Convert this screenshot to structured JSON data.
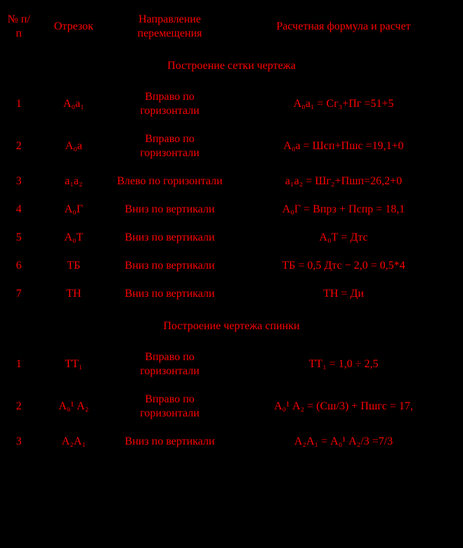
{
  "header": {
    "col_num": "№ п/п",
    "col_segment": "Отрезок",
    "col_direction": "Направление перемещения",
    "col_formula": "Расчетная формула и расчет"
  },
  "section_net": "Построение сетки чертежа",
  "section_back": "Построение чертежа спинки",
  "net_rows": [
    {
      "n": "1",
      "seg": "А₀а₁",
      "dir": "Вправо по горизонтали",
      "form": "А₀а₁ = Сг₃+Пг =51+5"
    },
    {
      "n": "2",
      "seg": "А₀а",
      "dir": "Вправо по горизонтали",
      "form": "А₀а = Шсп+Пшс =19,1+0"
    },
    {
      "n": "3",
      "seg": "а₁а₂",
      "dir": "Влево по горизонтали",
      "form": "а₁а₂ = Шг₂+Пшп=26,2+0"
    },
    {
      "n": "4",
      "seg": "А₀Г",
      "dir": "Вниз по вертикали",
      "form": "А₀Г = Впрз + Пспр = 18,1"
    },
    {
      "n": "5",
      "seg": "А₀Т",
      "dir": "Вниз по вертикали",
      "form": "А₀Т = Дтс"
    },
    {
      "n": "6",
      "seg": "ТБ",
      "dir": "Вниз по вертикали",
      "form": "ТБ = 0,5 Дтс − 2,0 = 0,5*4"
    },
    {
      "n": "7",
      "seg": "ТН",
      "dir": "Вниз по вертикали",
      "form": "ТН = Ди"
    }
  ],
  "back_rows": [
    {
      "n": "1",
      "seg": "ТТ₁",
      "dir": "Вправо по горизонтали",
      "form": "ТТ₁ = 1,0  ÷  2,5"
    },
    {
      "n": "2",
      "seg": "А₀¹ А₂",
      "dir": "Вправо по горизонтали",
      "form": "А₀¹ А₂ = (Сш/3) + Пшгс = 17,"
    },
    {
      "n": "3",
      "seg": "А₂А₁",
      "dir": "Вниз по вертикали",
      "form": "А₂А₁ = А₀¹ А₂/3 =7/3"
    }
  ]
}
